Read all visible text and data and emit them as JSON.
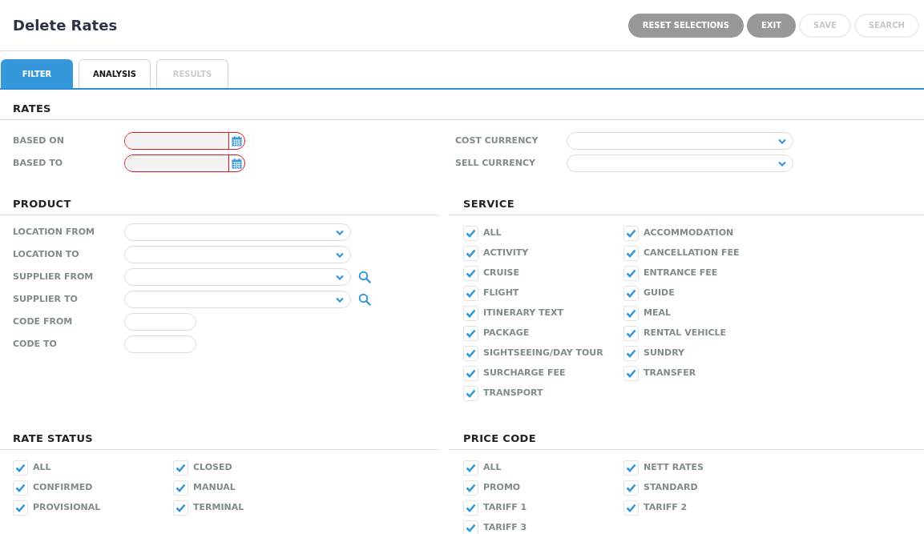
{
  "title": "Delete Rates",
  "actions": [
    {
      "label": "RESET SELECTIONS",
      "disabled": false
    },
    {
      "label": "EXIT",
      "disabled": false
    },
    {
      "label": "SAVE",
      "disabled": true
    },
    {
      "label": "SEARCH",
      "disabled": true
    }
  ],
  "tabs": [
    {
      "label": "FILTER",
      "selected": true,
      "disabled": false
    },
    {
      "label": "ANALYSIS",
      "selected": false,
      "disabled": false
    },
    {
      "label": "RESULTS",
      "selected": false,
      "disabled": true
    }
  ],
  "rates": {
    "heading": "RATES",
    "left": [
      {
        "label": "BASED ON",
        "kind": "date",
        "invalid": true
      },
      {
        "label": "BASED TO",
        "kind": "date",
        "invalid": true
      }
    ],
    "right": [
      {
        "label": "COST CURRENCY",
        "kind": "select"
      },
      {
        "label": "SELL CURRENCY",
        "kind": "select"
      }
    ]
  },
  "product": {
    "heading": "PRODUCT",
    "fields": [
      {
        "label": "LOCATION FROM",
        "kind": "select"
      },
      {
        "label": "LOCATION TO",
        "kind": "select"
      },
      {
        "label": "SUPPLIER FROM",
        "kind": "select-search"
      },
      {
        "label": "SUPPLIER TO",
        "kind": "select-search"
      },
      {
        "label": "CODE FROM",
        "kind": "text"
      },
      {
        "label": "CODE TO",
        "kind": "text"
      }
    ]
  },
  "service": {
    "heading": "SERVICE",
    "columns": [
      [
        {
          "label": "ALL",
          "checked": true
        },
        {
          "label": "ACTIVITY",
          "checked": true
        },
        {
          "label": "CRUISE",
          "checked": true
        },
        {
          "label": "FLIGHT",
          "checked": true
        },
        {
          "label": "ITINERARY TEXT",
          "checked": true
        },
        {
          "label": "PACKAGE",
          "checked": true
        },
        {
          "label": "SIGHTSEEING/DAY TOUR",
          "checked": true
        },
        {
          "label": "SURCHARGE FEE",
          "checked": true
        },
        {
          "label": "TRANSPORT",
          "checked": true
        }
      ],
      [
        {
          "label": "ACCOMMODATION",
          "checked": true
        },
        {
          "label": "CANCELLATION FEE",
          "checked": true
        },
        {
          "label": "ENTRANCE FEE",
          "checked": true
        },
        {
          "label": "GUIDE",
          "checked": true
        },
        {
          "label": "MEAL",
          "checked": true
        },
        {
          "label": "RENTAL VEHICLE",
          "checked": true
        },
        {
          "label": "SUNDRY",
          "checked": true
        },
        {
          "label": "TRANSFER",
          "checked": true
        }
      ]
    ]
  },
  "rate_status": {
    "heading": "RATE STATUS",
    "columns": [
      [
        {
          "label": "ALL",
          "checked": true
        },
        {
          "label": "CONFIRMED",
          "checked": true
        },
        {
          "label": "PROVISIONAL",
          "checked": true
        }
      ],
      [
        {
          "label": "CLOSED",
          "checked": true
        },
        {
          "label": "MANUAL",
          "checked": true
        },
        {
          "label": "TERMINAL",
          "checked": true
        }
      ]
    ]
  },
  "price_code": {
    "heading": "PRICE CODE",
    "columns": [
      [
        {
          "label": "ALL",
          "checked": true
        },
        {
          "label": "PROMO",
          "checked": true
        },
        {
          "label": "TARIFF 1",
          "checked": true
        },
        {
          "label": "TARIFF 3",
          "checked": true
        }
      ],
      [
        {
          "label": "NETT RATES",
          "checked": true
        },
        {
          "label": "STANDARD",
          "checked": true
        },
        {
          "label": "TARIFF 2",
          "checked": true
        }
      ]
    ]
  }
}
